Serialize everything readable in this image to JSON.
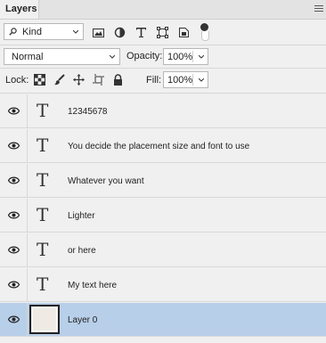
{
  "panel": {
    "tab_label": "Layers"
  },
  "filter": {
    "kind_label": "Kind"
  },
  "blend": {
    "mode": "Normal",
    "opacity_label": "Opacity:",
    "opacity_value": "100%"
  },
  "lock": {
    "label": "Lock:",
    "fill_label": "Fill:",
    "fill_value": "100%"
  },
  "layers": [
    {
      "name": "12345678",
      "type": "text",
      "selected": false
    },
    {
      "name": "You decide the placement size and font to use",
      "type": "text",
      "selected": false
    },
    {
      "name": "Whatever you want",
      "type": "text",
      "selected": false
    },
    {
      "name": "Lighter",
      "type": "text",
      "selected": false
    },
    {
      "name": "or here",
      "type": "text",
      "selected": false
    },
    {
      "name": "My text here",
      "type": "text",
      "selected": false
    },
    {
      "name": "Layer 0",
      "type": "pixel",
      "selected": true
    }
  ],
  "text_glyph": "T",
  "colors": {
    "selected_row": "#b8cfe9",
    "panel_bg": "#f0f0f0"
  }
}
